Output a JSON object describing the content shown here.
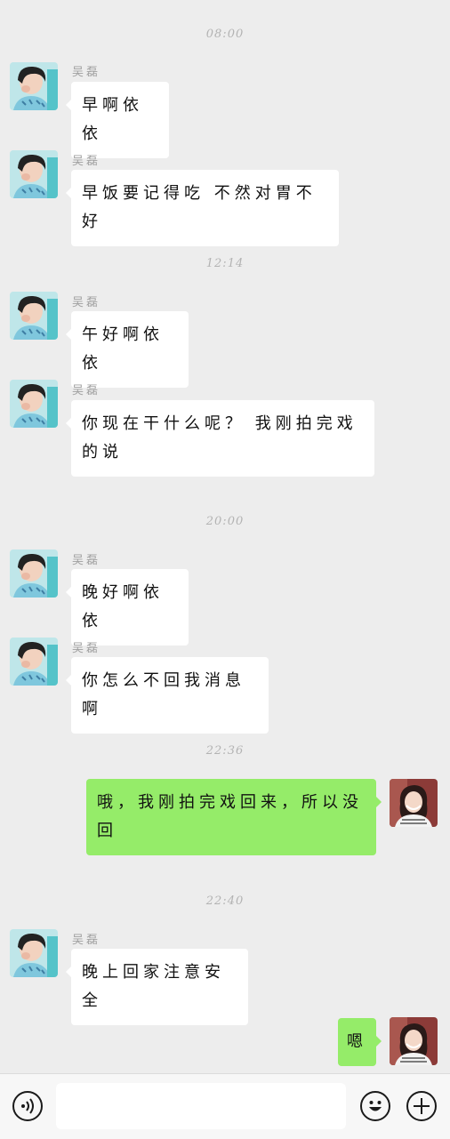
{
  "contact_name": "吴磊",
  "messages": [
    {
      "type": "time",
      "text": "08:00"
    },
    {
      "type": "in",
      "text": "早啊依依"
    },
    {
      "type": "in",
      "text": "早饭要记得吃  不然对胃不好"
    },
    {
      "type": "time",
      "text": "12:14"
    },
    {
      "type": "in",
      "text": "午好啊依依"
    },
    {
      "type": "in",
      "text": "你现在干什么呢？  我刚拍完戏的说"
    },
    {
      "type": "time",
      "text": "20:00"
    },
    {
      "type": "in",
      "text": "晚好啊依依"
    },
    {
      "type": "in",
      "text": "你怎么不回我消息啊"
    },
    {
      "type": "time",
      "text": "22:36"
    },
    {
      "type": "out",
      "text": "哦，我刚拍完戏回来，所以没回"
    },
    {
      "type": "time",
      "text": "22:40"
    },
    {
      "type": "in",
      "text": "晚上回家注意安全"
    },
    {
      "type": "out",
      "text": "嗯"
    }
  ],
  "input": {
    "placeholder": ""
  },
  "icons": {
    "voice": "voice-icon",
    "emoji": "emoji-icon",
    "add": "plus-icon"
  },
  "colors": {
    "background": "#ededed",
    "incoming_bubble": "#ffffff",
    "outgoing_bubble": "#95ec69",
    "time_text": "#b3b3b3"
  }
}
